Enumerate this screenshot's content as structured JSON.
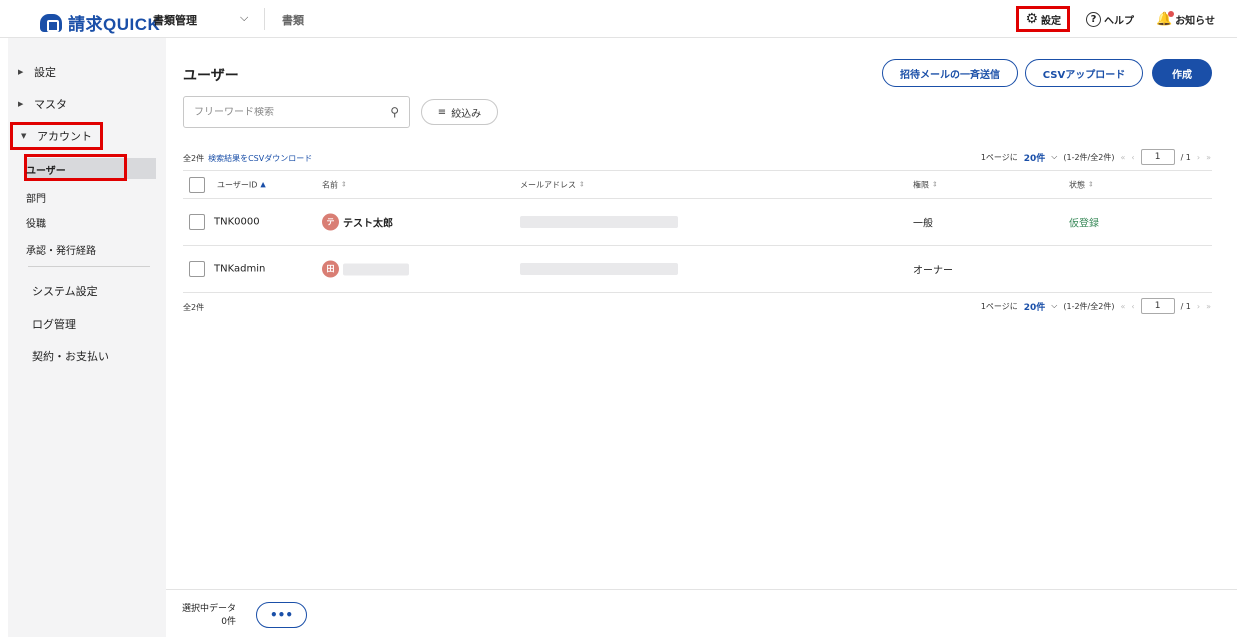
{
  "header": {
    "logo_text": "請求QUICK",
    "app_select": "書類管理",
    "docs_link": "書類",
    "settings_label": "設定",
    "help_label": "ヘルプ",
    "notice_label": "お知らせ"
  },
  "sidebar": {
    "settings": "設定",
    "master": "マスタ",
    "account": "アカウント",
    "sub": [
      "ユーザー",
      "部門",
      "役職",
      "承認・発行経路"
    ],
    "main": [
      "システム設定",
      "ログ管理",
      "契約・お支払い"
    ]
  },
  "main": {
    "title": "ユーザー",
    "invite_button": "招待メールの一斉送信",
    "csv_button": "CSVアップロード",
    "create_button": "作成",
    "search_placeholder": "フリーワード検索",
    "filter_label": "絞込み",
    "total": "全2件",
    "csv_download": "検索結果をCSVダウンロード",
    "pager": {
      "per_page_prefix": "1ページに",
      "per_page": "20件",
      "range": "(1-2件/全2件)",
      "page": "1",
      "of": "/ 1"
    },
    "columns": {
      "user_id": "ユーザーID",
      "name": "名前",
      "email": "メールアドレス",
      "role": "権限",
      "status": "状態"
    },
    "rows": [
      {
        "user_id": "TNK0000",
        "avatar": "テ",
        "name": "テスト太郎",
        "role": "一般",
        "status": "仮登録"
      },
      {
        "user_id": "TNKadmin",
        "avatar": "田",
        "name": "",
        "role": "オーナー",
        "status": ""
      }
    ]
  },
  "footer": {
    "selected_label": "選択中データ",
    "selected_count": "0件",
    "more": "•••"
  }
}
